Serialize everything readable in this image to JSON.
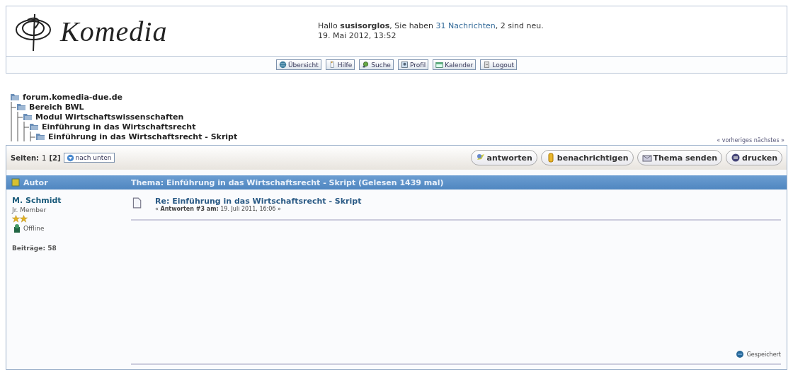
{
  "header": {
    "logo_text": "Komedia",
    "greeting": {
      "before": "Hallo **susisorglos**, Sie haben ",
      "link": "31 Nachrichten",
      "after": ", 2 sind neu."
    },
    "date": "19. Mai 2012, 13:52",
    "nav": [
      "Übersicht",
      "Hilfe",
      "Suche",
      "Profil",
      "Kalender",
      "Logout"
    ]
  },
  "breadcrumb": [
    {
      "label": "forum.komedia-due.de",
      "children": [
        {
          "label": "Bereich BWL",
          "children": [
            {
              "label": "Modul Wirtschaftswissenschaften",
              "children": [
                {
                  "label": "Einführung in das Wirtschaftsrecht",
                  "children": [
                    {
                      "label": "Einführung in das Wirtschaftsrecht - Skript"
                    }
                  ]
                }
              ]
            }
          ]
        }
      ]
    }
  ],
  "prev_next": "« vorheriges nächstes »",
  "pages": {
    "label": "Seiten:",
    "items": [
      {
        "label": "1",
        "selected": false
      },
      {
        "label": "[2]",
        "selected": true
      }
    ],
    "down_button": "nach unten"
  },
  "actions": [
    "antworten",
    "benachrichtigen",
    "Thema senden",
    "drucken"
  ],
  "table_header": {
    "author": "Autor",
    "topic": "Thema: Einführung in das Wirtschaftsrecht - Skript  (Gelesen 1439 mal)"
  },
  "post": {
    "author": "M. Schmidt",
    "rank": "Jr. Member",
    "online": false,
    "status": "Offline",
    "posts": "Beiträge: 58",
    "title": "Re: Einführung in das Wirtschaftsrecht - Skript",
    "meta": "« **Antworten #3 am:** 19. Juli 2011, 16:06 »",
    "saved": "Gespeichert"
  }
}
